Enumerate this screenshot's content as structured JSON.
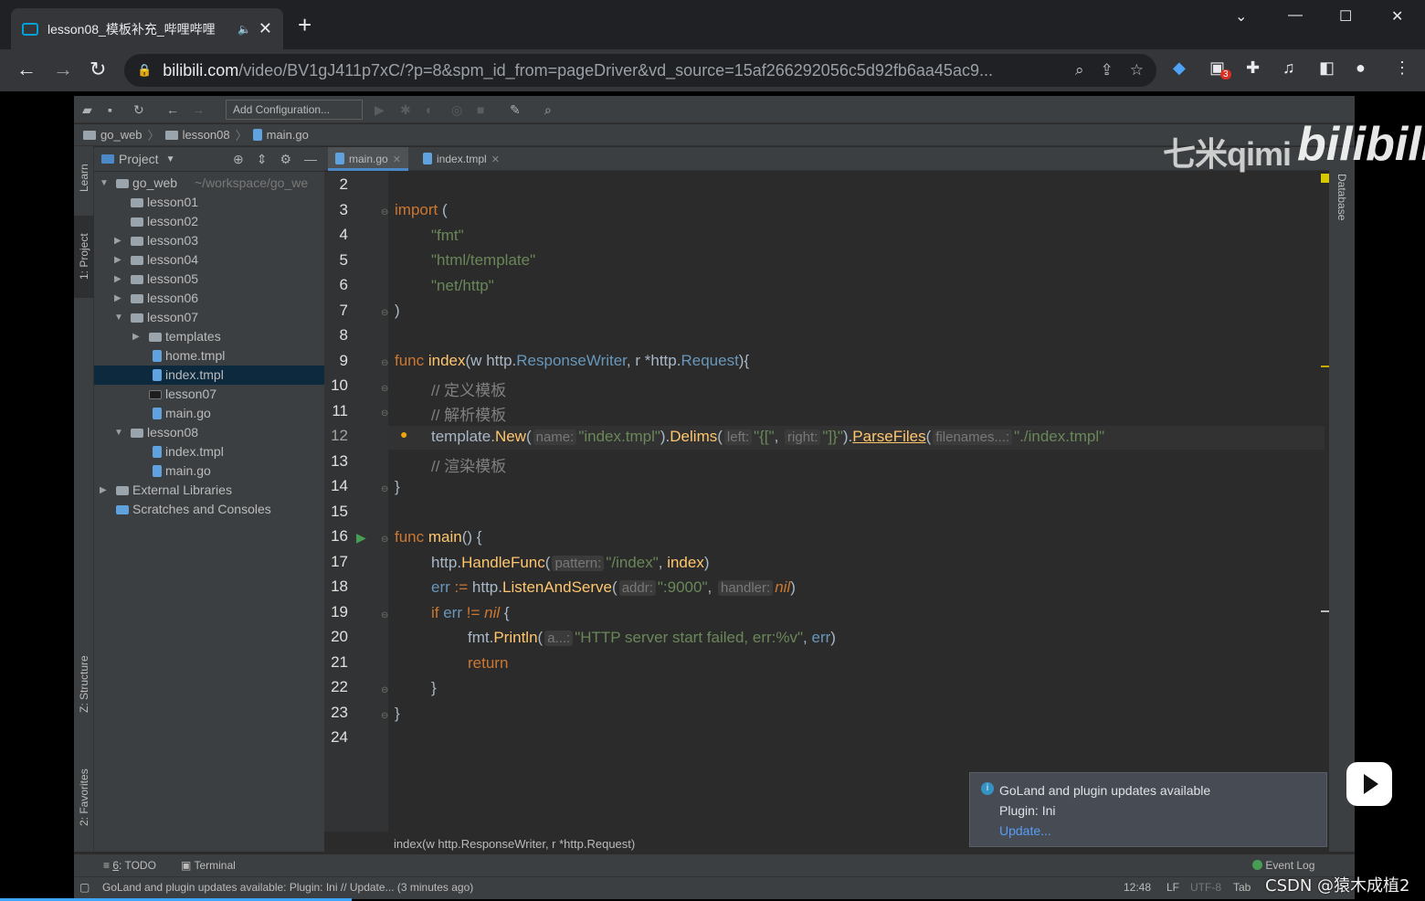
{
  "browser": {
    "tab_title": "lesson08_模板补充_哔哩哔哩",
    "tab_close": "✕",
    "new_tab": "+",
    "url_host": "bilibili.com",
    "url_path": "/video/BV1gJ411p7xC/?p=8&spm_id_from=pageDriver&vd_source=15af266292056c5d92fb6aa45ac9...",
    "extension_badge": "3"
  },
  "ide": {
    "add_configuration": "Add Configuration...",
    "breadcrumbs": [
      "go_web",
      "lesson08",
      "main.go"
    ],
    "left_tabs": {
      "learn": "Learn",
      "project": "1: Project",
      "structure": "Z: Structure",
      "favorites": "2: Favorites"
    },
    "right_tab": "Database",
    "project_header": "Project",
    "tree": [
      {
        "label": "go_web",
        "extra": "~/workspace/go_we",
        "depth": 0,
        "arrow": "▼",
        "icon": "folder"
      },
      {
        "label": "lesson01",
        "depth": 1,
        "arrow": "",
        "icon": "folder"
      },
      {
        "label": "lesson02",
        "depth": 1,
        "arrow": "",
        "icon": "folder"
      },
      {
        "label": "lesson03",
        "depth": 1,
        "arrow": "▶",
        "icon": "folder"
      },
      {
        "label": "lesson04",
        "depth": 1,
        "arrow": "▶",
        "icon": "folder"
      },
      {
        "label": "lesson05",
        "depth": 1,
        "arrow": "▶",
        "icon": "folder"
      },
      {
        "label": "lesson06",
        "depth": 1,
        "arrow": "▶",
        "icon": "folder"
      },
      {
        "label": "lesson07",
        "depth": 1,
        "arrow": "▼",
        "icon": "folder"
      },
      {
        "label": "templates",
        "depth": 2,
        "arrow": "▶",
        "icon": "folder"
      },
      {
        "label": "home.tmpl",
        "depth": 2,
        "arrow": "",
        "icon": "file"
      },
      {
        "label": "index.tmpl",
        "depth": 2,
        "arrow": "",
        "icon": "file",
        "selected": true
      },
      {
        "label": "lesson07",
        "depth": 2,
        "arrow": "",
        "icon": "exec"
      },
      {
        "label": "main.go",
        "depth": 2,
        "arrow": "",
        "icon": "file"
      },
      {
        "label": "lesson08",
        "depth": 1,
        "arrow": "▼",
        "icon": "folder"
      },
      {
        "label": "index.tmpl",
        "depth": 2,
        "arrow": "",
        "icon": "file"
      },
      {
        "label": "main.go",
        "depth": 2,
        "arrow": "",
        "icon": "file"
      },
      {
        "label": "External Libraries",
        "depth": 0,
        "arrow": "▶",
        "icon": "lib"
      },
      {
        "label": "Scratches and Consoles",
        "depth": 0,
        "arrow": "",
        "icon": "scratch"
      }
    ],
    "editor_tabs": [
      {
        "label": "main.go",
        "active": true
      },
      {
        "label": "index.tmpl",
        "active": false
      }
    ],
    "line_numbers": [
      "2",
      "3",
      "4",
      "5",
      "6",
      "7",
      "8",
      "9",
      "10",
      "11",
      "12",
      "13",
      "14",
      "15",
      "16",
      "17",
      "18",
      "19",
      "20",
      "21",
      "22",
      "23",
      "24"
    ],
    "code": {
      "l3_kw": "import",
      "l3_rest": " (",
      "l4": "\"fmt\"",
      "l5": "\"html/template\"",
      "l6": "\"net/http\"",
      "l7": ")",
      "l9_kw": "func",
      "l9_fn": "index",
      "l9_a": "(w ",
      "l9_b": "http",
      "l9_c": ".",
      "l9_d": "ResponseWriter",
      "l9_e": ", r *",
      "l9_f": "http",
      "l9_g": ".",
      "l9_h": "Request",
      "l9_i": "){",
      "l10": "// 定义模板",
      "l11": "// 解析模板",
      "l12_a": "template",
      "l12_b": ".",
      "l12_c": "New",
      "l12_d": "(",
      "l12_hint1": "name:",
      "l12_s1": "\"index.tmpl\"",
      "l12_e": ").",
      "l12_f": "Delims",
      "l12_g": "(",
      "l12_hint2": "left:",
      "l12_s2": "\"{[\"",
      "l12_h": ",",
      "l12_hint3": "right:",
      "l12_s3": "\"]}\"",
      "l12_i": ").",
      "l12_j": "ParseFiles",
      "l12_k": "(",
      "l12_hint4": "filenames...:",
      "l12_s4": "\"./index.tmpl\"",
      "l13": "// 渲染模板",
      "l14": "}",
      "l16_kw": "func",
      "l16_fn": "main",
      "l16_rest": "() {",
      "l17_a": "http",
      "l17_b": ".",
      "l17_c": "HandleFunc",
      "l17_d": "(",
      "l17_hint": "pattern:",
      "l17_s": "\"/index\"",
      "l17_e": ", ",
      "l17_f": "index",
      "l17_g": ")",
      "l18_a": "err",
      "l18_b": " := ",
      "l18_c": "http",
      "l18_d": ".",
      "l18_e": "ListenAndServe",
      "l18_f": "(",
      "l18_hint1": "addr:",
      "l18_s": "\":9000\"",
      "l18_g": ",",
      "l18_hint2": "handler:",
      "l18_nil": "nil",
      "l18_h": ")",
      "l19_kw": "if",
      "l19_a": " err",
      "l19_b": " != ",
      "l19_nil": "nil",
      "l19_c": " {",
      "l20_a": "fmt",
      "l20_b": ".",
      "l20_c": "Println",
      "l20_d": "(",
      "l20_hint": "a...:",
      "l20_s": "\"HTTP server start failed, err:%v\"",
      "l20_e": ", ",
      "l20_f": "err",
      "l20_g": ")",
      "l21": "return",
      "l22": "}",
      "l23": "}"
    },
    "signature_hint": "index(w http.ResponseWriter, r *http.Request)",
    "notification": {
      "title": "GoLand and plugin updates available",
      "body": "Plugin: Ini",
      "link": "Update..."
    },
    "bottom_tabs": {
      "todo_num": "6",
      "todo": ": TODO",
      "terminal": "Terminal",
      "event_log": "Event Log"
    },
    "status": {
      "message": "GoLand and plugin updates available: Plugin: Ini // Update... (3 minutes ago)",
      "position": "12:48",
      "line_sep": "LF",
      "encoding": "UTF-8",
      "indent": "Tab"
    }
  },
  "overlay": {
    "watermark_name": "七米qimi",
    "watermark_logo": "bilibili",
    "csdn": "CSDN @猿木成植2"
  },
  "colors": {
    "keyword": "#cc7832",
    "string": "#6a8759",
    "function": "#ffc66d",
    "comment": "#808080",
    "selection": "#0d293e"
  }
}
